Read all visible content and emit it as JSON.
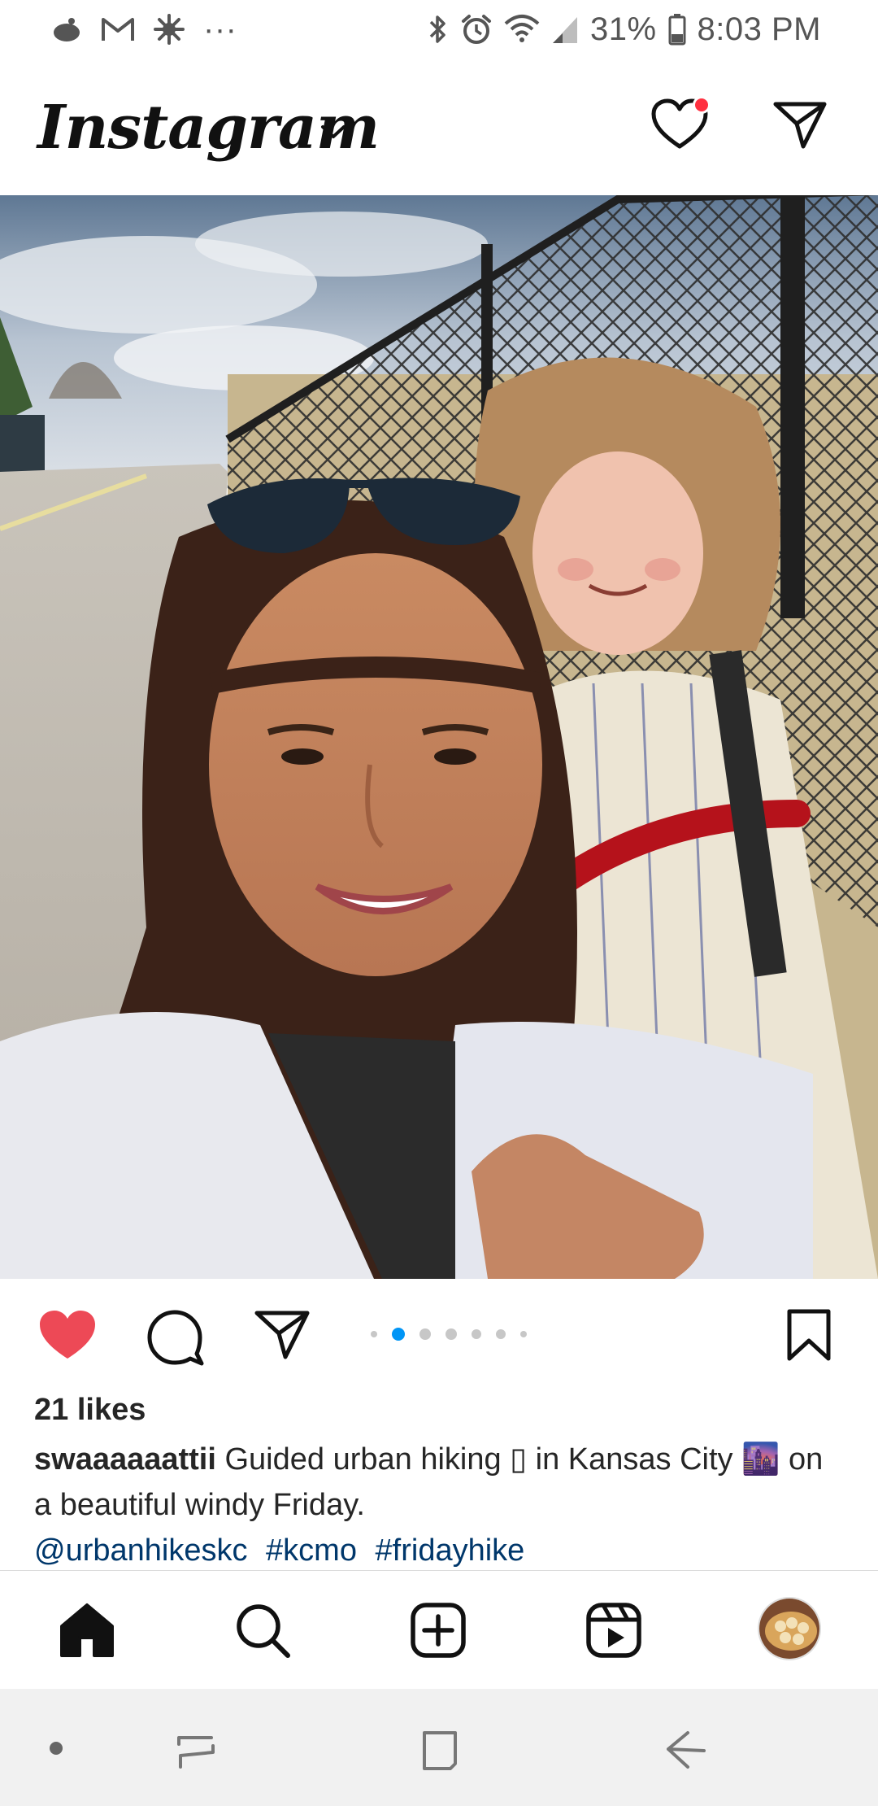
{
  "status_bar": {
    "battery": "31%",
    "time": "8:03 PM",
    "overflow": "···",
    "icons": [
      "notification-app-icon",
      "gmail-icon",
      "settings-burst-icon",
      "bluetooth-icon",
      "alarm-icon",
      "wifi-icon",
      "signal-icon",
      "battery-icon"
    ]
  },
  "header": {
    "title": "Instagram",
    "icons": [
      "chevron-down-icon",
      "heart-icon",
      "direct-message-icon"
    ],
    "accent_color": "#ff3040"
  },
  "post": {
    "photo_description_icon": "selfie-photo",
    "like_color": "#ed4956",
    "carousel": {
      "count": 6,
      "active_index": 1,
      "active_color": "#0095f6"
    },
    "likes": "21 likes",
    "caption": {
      "username": "swaaaaaattii",
      "text": "Guided urban hiking ▯ in Kansas City 🌆 on a beautiful windy Friday.",
      "tags": [
        "@urbanhikeskc",
        "#kcmo",
        "#fridayhike"
      ],
      "tag_color": "#00376b"
    },
    "action_icons": [
      "heart-filled-icon",
      "comment-icon",
      "share-icon",
      "bookmark-icon"
    ]
  },
  "bottom_nav": {
    "items": [
      "home-icon",
      "search-icon",
      "create-post-icon",
      "reels-icon",
      "profile-avatar"
    ]
  },
  "system_nav": {
    "items": [
      "dot-icon",
      "recents-icon",
      "home-square-icon",
      "back-icon"
    ]
  }
}
